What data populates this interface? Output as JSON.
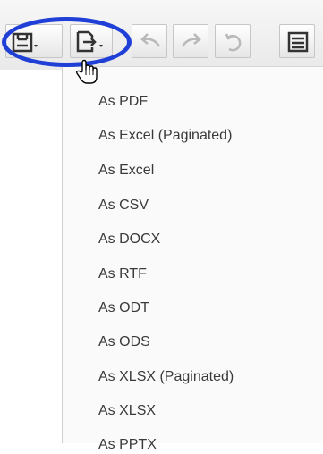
{
  "toolbar": {
    "buttons": [
      {
        "icon": "save-icon",
        "has_dropdown": true,
        "enabled": true
      },
      {
        "icon": "export-icon",
        "has_dropdown": true,
        "enabled": true
      },
      {
        "icon": "undo-icon",
        "has_dropdown": false,
        "enabled": false
      },
      {
        "icon": "redo-icon",
        "has_dropdown": false,
        "enabled": false
      },
      {
        "icon": "revert-icon",
        "has_dropdown": false,
        "enabled": false
      },
      {
        "icon": "report-icon",
        "has_dropdown": false,
        "enabled": true
      }
    ],
    "highlight_color": "#1f3fd6"
  },
  "export_menu": {
    "items": [
      "As PDF",
      "As Excel (Paginated)",
      "As Excel",
      "As CSV",
      "As DOCX",
      "As RTF",
      "As ODT",
      "As ODS",
      "As XLSX (Paginated)",
      "As XLSX",
      "As PPTX"
    ]
  }
}
